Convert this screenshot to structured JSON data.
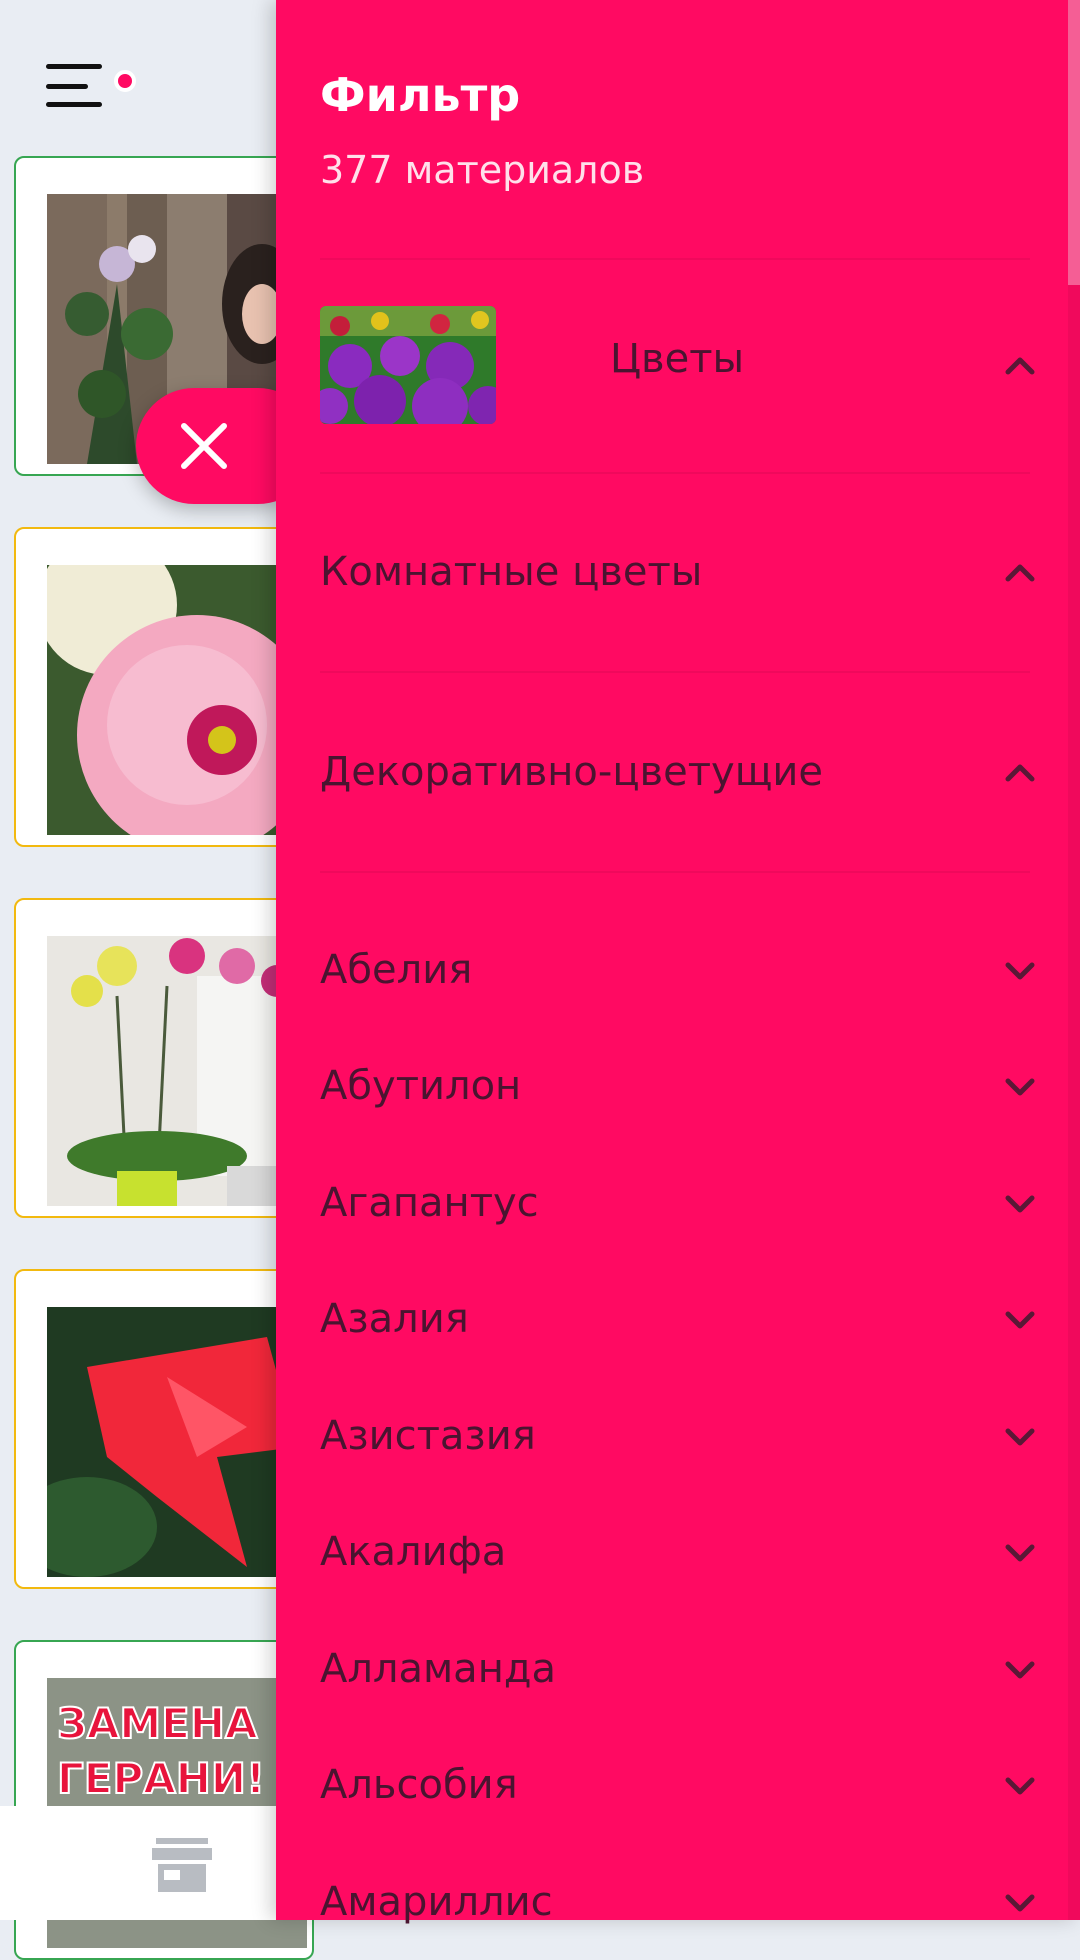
{
  "drawer": {
    "title": "Фильтр",
    "count": "377 материалов",
    "category": {
      "label": "Цветы"
    },
    "sections": [
      {
        "label": "Комнатные цветы"
      },
      {
        "label": "Декоративно-цветущие"
      }
    ],
    "items": [
      {
        "label": "Абелия"
      },
      {
        "label": "Абутилон"
      },
      {
        "label": "Агапантус"
      },
      {
        "label": "Азалия"
      },
      {
        "label": "Азистазия"
      },
      {
        "label": "Акалифа"
      },
      {
        "label": "Алламанда"
      },
      {
        "label": "Альсобия"
      },
      {
        "label": "Амариллис"
      }
    ]
  },
  "background": {
    "cards": [
      {
        "border": "#37a652",
        "image": "woman-with-flowers"
      },
      {
        "border": "#f2b90f",
        "image": "pink-flower"
      },
      {
        "border": "#f2b90f",
        "image": "orchids"
      },
      {
        "border": "#f2b90f",
        "image": "red-flower"
      },
      {
        "border": "#37a652",
        "image": "geranium-poster",
        "text": "ЗАМЕНА ГЕРАНИ!"
      }
    ]
  },
  "colors": {
    "accent": "#ff0a62",
    "text_dark": "#4a1430",
    "background": "#e9edf3"
  }
}
